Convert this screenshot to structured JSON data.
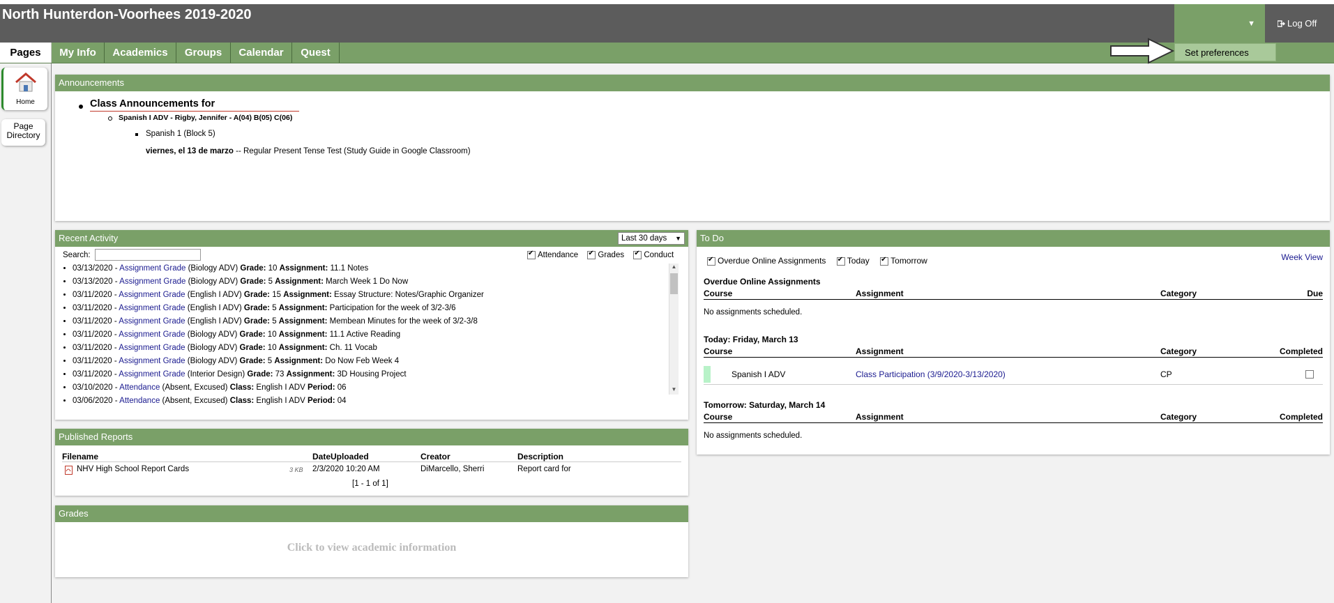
{
  "header": {
    "school_name": "North Hunterdon-Voorhees 2019-2020",
    "logoff_label": "Log Off",
    "logoff_icon": "logoff-icon",
    "caret": "▼"
  },
  "prefs_menu": {
    "label": "Set preferences"
  },
  "nav": {
    "tabs": [
      {
        "label": "Pages"
      },
      {
        "label": "My Info"
      },
      {
        "label": "Academics"
      },
      {
        "label": "Groups"
      },
      {
        "label": "Calendar"
      },
      {
        "label": "Quest"
      }
    ]
  },
  "sidebar": {
    "home_label": "Home",
    "page_directory_label": "Page Directory"
  },
  "announcements": {
    "title": "Announcements",
    "heading": "Class Announcements for",
    "class_line": "Spanish I ADV - Rigby, Jennifer - A(04) B(05) C(06)",
    "section": "Spanish 1 (Block 5)",
    "date": "viernes, el 13 de marzo",
    "note": " -- Regular Present Tense Test (Study Guide in Google Classroom)"
  },
  "recent_activity": {
    "title": "Recent Activity",
    "range": "Last 30 days",
    "search_label": "Search:",
    "search_value": "",
    "filters": [
      "Attendance",
      "Grades",
      "Conduct"
    ],
    "items": [
      {
        "date": "03/13/2020 - ",
        "link": "Assignment Grade",
        "course": " (Biology ADV) ",
        "k1": "Grade:",
        "v1": " 10 ",
        "k2": "Assignment:",
        "v2": " 11.1 Notes"
      },
      {
        "date": "03/13/2020 - ",
        "link": "Assignment Grade",
        "course": " (Biology ADV) ",
        "k1": "Grade:",
        "v1": " 5 ",
        "k2": "Assignment:",
        "v2": " March Week 1 Do Now"
      },
      {
        "date": "03/11/2020 - ",
        "link": "Assignment Grade",
        "course": " (English I ADV) ",
        "k1": "Grade:",
        "v1": " 15 ",
        "k2": "Assignment:",
        "v2": " Essay Structure: Notes/Graphic Organizer"
      },
      {
        "date": "03/11/2020 - ",
        "link": "Assignment Grade",
        "course": " (English I ADV) ",
        "k1": "Grade:",
        "v1": " 5 ",
        "k2": "Assignment:",
        "v2": " Participation for the week of 3/2-3/6"
      },
      {
        "date": "03/11/2020 - ",
        "link": "Assignment Grade",
        "course": " (English I ADV) ",
        "k1": "Grade:",
        "v1": " 5 ",
        "k2": "Assignment:",
        "v2": " Membean Minutes for the week of 3/2-3/8"
      },
      {
        "date": "03/11/2020 - ",
        "link": "Assignment Grade",
        "course": " (Biology ADV) ",
        "k1": "Grade:",
        "v1": " 10 ",
        "k2": "Assignment:",
        "v2": " 11.1 Active Reading"
      },
      {
        "date": "03/11/2020 - ",
        "link": "Assignment Grade",
        "course": " (Biology ADV) ",
        "k1": "Grade:",
        "v1": " 10 ",
        "k2": "Assignment:",
        "v2": " Ch. 11 Vocab"
      },
      {
        "date": "03/11/2020 - ",
        "link": "Assignment Grade",
        "course": " (Biology ADV) ",
        "k1": "Grade:",
        "v1": " 5 ",
        "k2": "Assignment:",
        "v2": " Do Now Feb Week 4"
      },
      {
        "date": "03/11/2020 - ",
        "link": "Assignment Grade",
        "course": " (Interior Design) ",
        "k1": "Grade:",
        "v1": " 73 ",
        "k2": "Assignment:",
        "v2": " 3D Housing Project"
      },
      {
        "date": "03/10/2020 - ",
        "link": "Attendance",
        "course": " (Absent, Excused) ",
        "k1": "Class:",
        "v1": " English I ADV ",
        "k2": "Period:",
        "v2": " 06"
      },
      {
        "date": "03/06/2020 - ",
        "link": "Attendance",
        "course": " (Absent, Excused) ",
        "k1": "Class:",
        "v1": " English I ADV ",
        "k2": "Period:",
        "v2": " 04"
      }
    ]
  },
  "published_reports": {
    "title": "Published Reports",
    "headers": [
      "Filename",
      "DateUploaded",
      "Creator",
      "Description"
    ],
    "row": {
      "filename": "NHV High School Report Cards",
      "size": "3 KB",
      "date": "2/3/2020 10:20 AM",
      "creator": "DiMarcello, Sherri",
      "description": "Report card for"
    },
    "pager": "[1 - 1 of 1]"
  },
  "grades": {
    "title": "Grades",
    "placeholder": "Click to view academic information"
  },
  "todo": {
    "title": "To Do",
    "filters": [
      "Overdue Online Assignments",
      "Today",
      "Tomorrow"
    ],
    "week_view": "Week View",
    "overdue": {
      "title": "Overdue Online Assignments",
      "headers": [
        "Course",
        "Assignment",
        "Category",
        "Due"
      ],
      "empty": "No assignments scheduled."
    },
    "today": {
      "title": "Today: Friday, March 13",
      "headers": [
        "Course",
        "Assignment",
        "Category",
        "Completed"
      ],
      "row": {
        "course": "Spanish I ADV",
        "assignment": "Class Participation (3/9/2020-3/13/2020)",
        "category": "CP"
      }
    },
    "tomorrow": {
      "title": "Tomorrow: Saturday, March 14",
      "headers": [
        "Course",
        "Assignment",
        "Category",
        "Completed"
      ],
      "empty": "No assignments scheduled."
    }
  },
  "colors": {
    "header_bg": "#5c5c5c",
    "accent_green": "#7aa068",
    "link_blue": "#1a1a8f"
  }
}
